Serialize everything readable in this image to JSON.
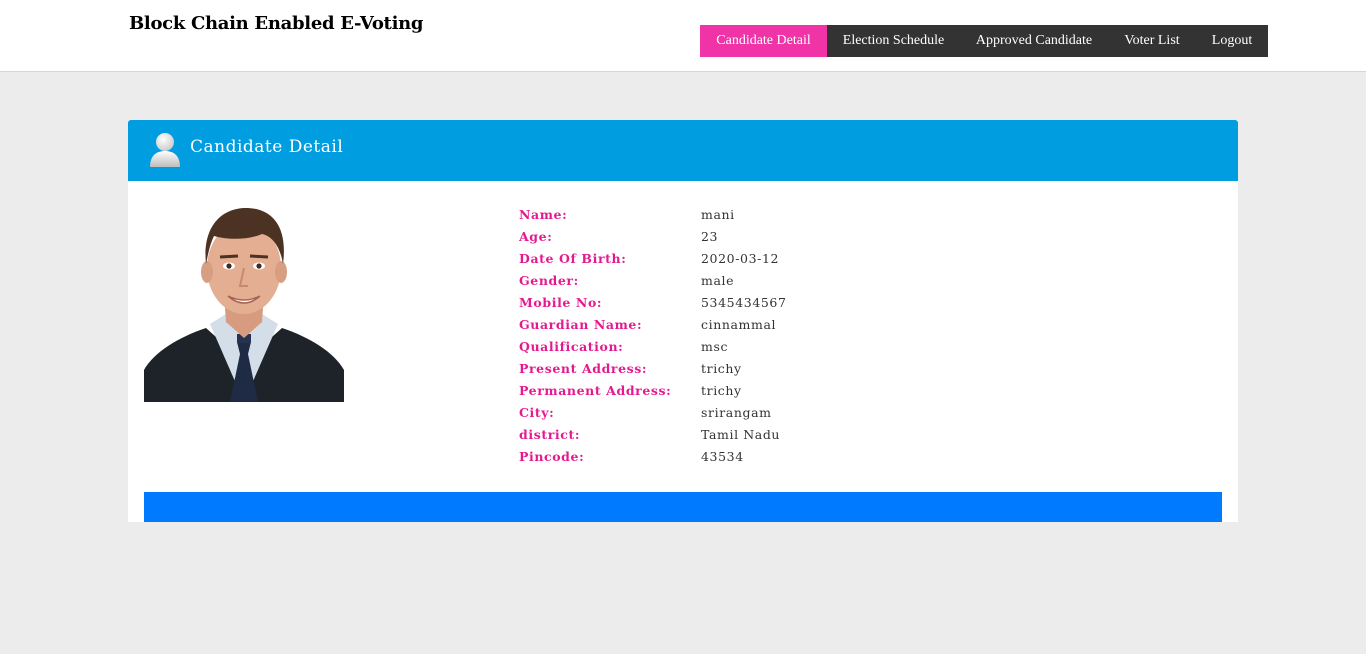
{
  "header": {
    "site_title": "Block Chain Enabled E-Voting",
    "nav": [
      {
        "label": "Candidate Detail",
        "active": true
      },
      {
        "label": "Election Schedule",
        "active": false
      },
      {
        "label": "Approved Candidate",
        "active": false
      },
      {
        "label": "Voter List",
        "active": false
      },
      {
        "label": "Logout",
        "active": false
      }
    ]
  },
  "panel": {
    "title": "Candidate Detail",
    "icon": "user-icon",
    "photo": "candidate-photo"
  },
  "details": [
    {
      "label": "Name:",
      "value": "mani"
    },
    {
      "label": "Age:",
      "value": "23"
    },
    {
      "label": "Date Of Birth:",
      "value": "2020-03-12"
    },
    {
      "label": "Gender:",
      "value": "male"
    },
    {
      "label": "Mobile No:",
      "value": "5345434567"
    },
    {
      "label": "Guardian Name:",
      "value": "cinnammal"
    },
    {
      "label": "Qualification:",
      "value": "msc"
    },
    {
      "label": "Present Address:",
      "value": "trichy"
    },
    {
      "label": "Permanent Address:",
      "value": "trichy"
    },
    {
      "label": "City:",
      "value": "srirangam"
    },
    {
      "label": "district:",
      "value": "Tamil Nadu"
    },
    {
      "label": "Pincode:",
      "value": "43534"
    }
  ],
  "colors": {
    "nav_active": "#f033a6",
    "nav_bg": "#333333",
    "panel_header": "#009de0",
    "label_color": "#e5198f",
    "bottom_bar": "#007bff",
    "page_bg": "#ececec"
  }
}
